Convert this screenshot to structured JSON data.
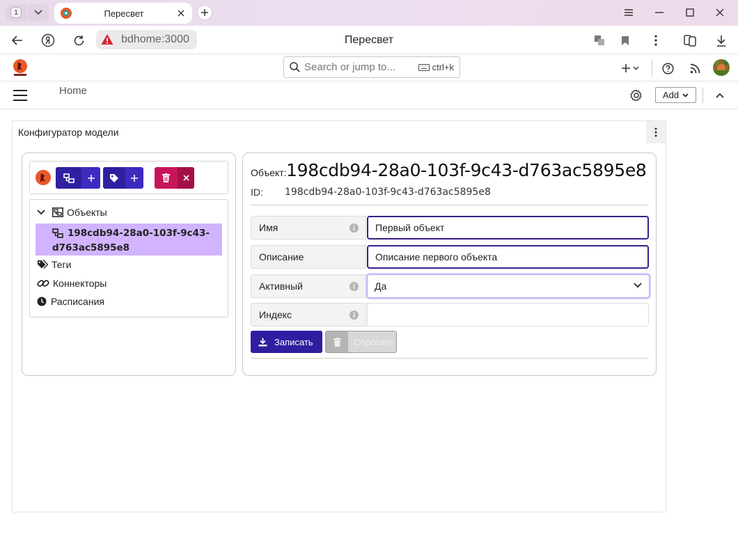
{
  "browser": {
    "tab_count": "1",
    "tab_title": "Пересвет",
    "url": "bdhome:3000",
    "page_title": "Пересвет"
  },
  "app": {
    "search": {
      "placeholder": "Search or jump to...",
      "shortcut": "ctrl+k"
    },
    "breadcrumb": "Home",
    "add_label": "Add"
  },
  "panel": {
    "title": "Конфигуратор модели",
    "tree": {
      "root_label": "Объекты",
      "selected_line1": "198cdb94-28a0-103f-9c43-",
      "selected_line2": "d763ac5895e8",
      "tags_label": "Теги",
      "connectors_label": "Коннекторы",
      "schedules_label": "Расписания"
    },
    "detail": {
      "object_label": "Объект:",
      "object_title": "198cdb94-28a0-103f-9c43-d763ac5895e8",
      "id_label": "ID:",
      "id_value": "198cdb94-28a0-103f-9c43-d763ac5895e8",
      "fields": {
        "name_label": "Имя",
        "name_value": "Первый объект",
        "description_label": "Описание",
        "description_value": "Описание первого объекта",
        "active_label": "Активный",
        "active_value": "Да",
        "index_label": "Индекс",
        "index_value": ""
      },
      "save_label": "Записать",
      "reset_label": "Сбросить"
    }
  },
  "colors": {
    "primary": "#2f1ea0",
    "danger": "#c8155a",
    "selected_row": "#d1b3ff",
    "input_border": "#3b1e8a"
  }
}
